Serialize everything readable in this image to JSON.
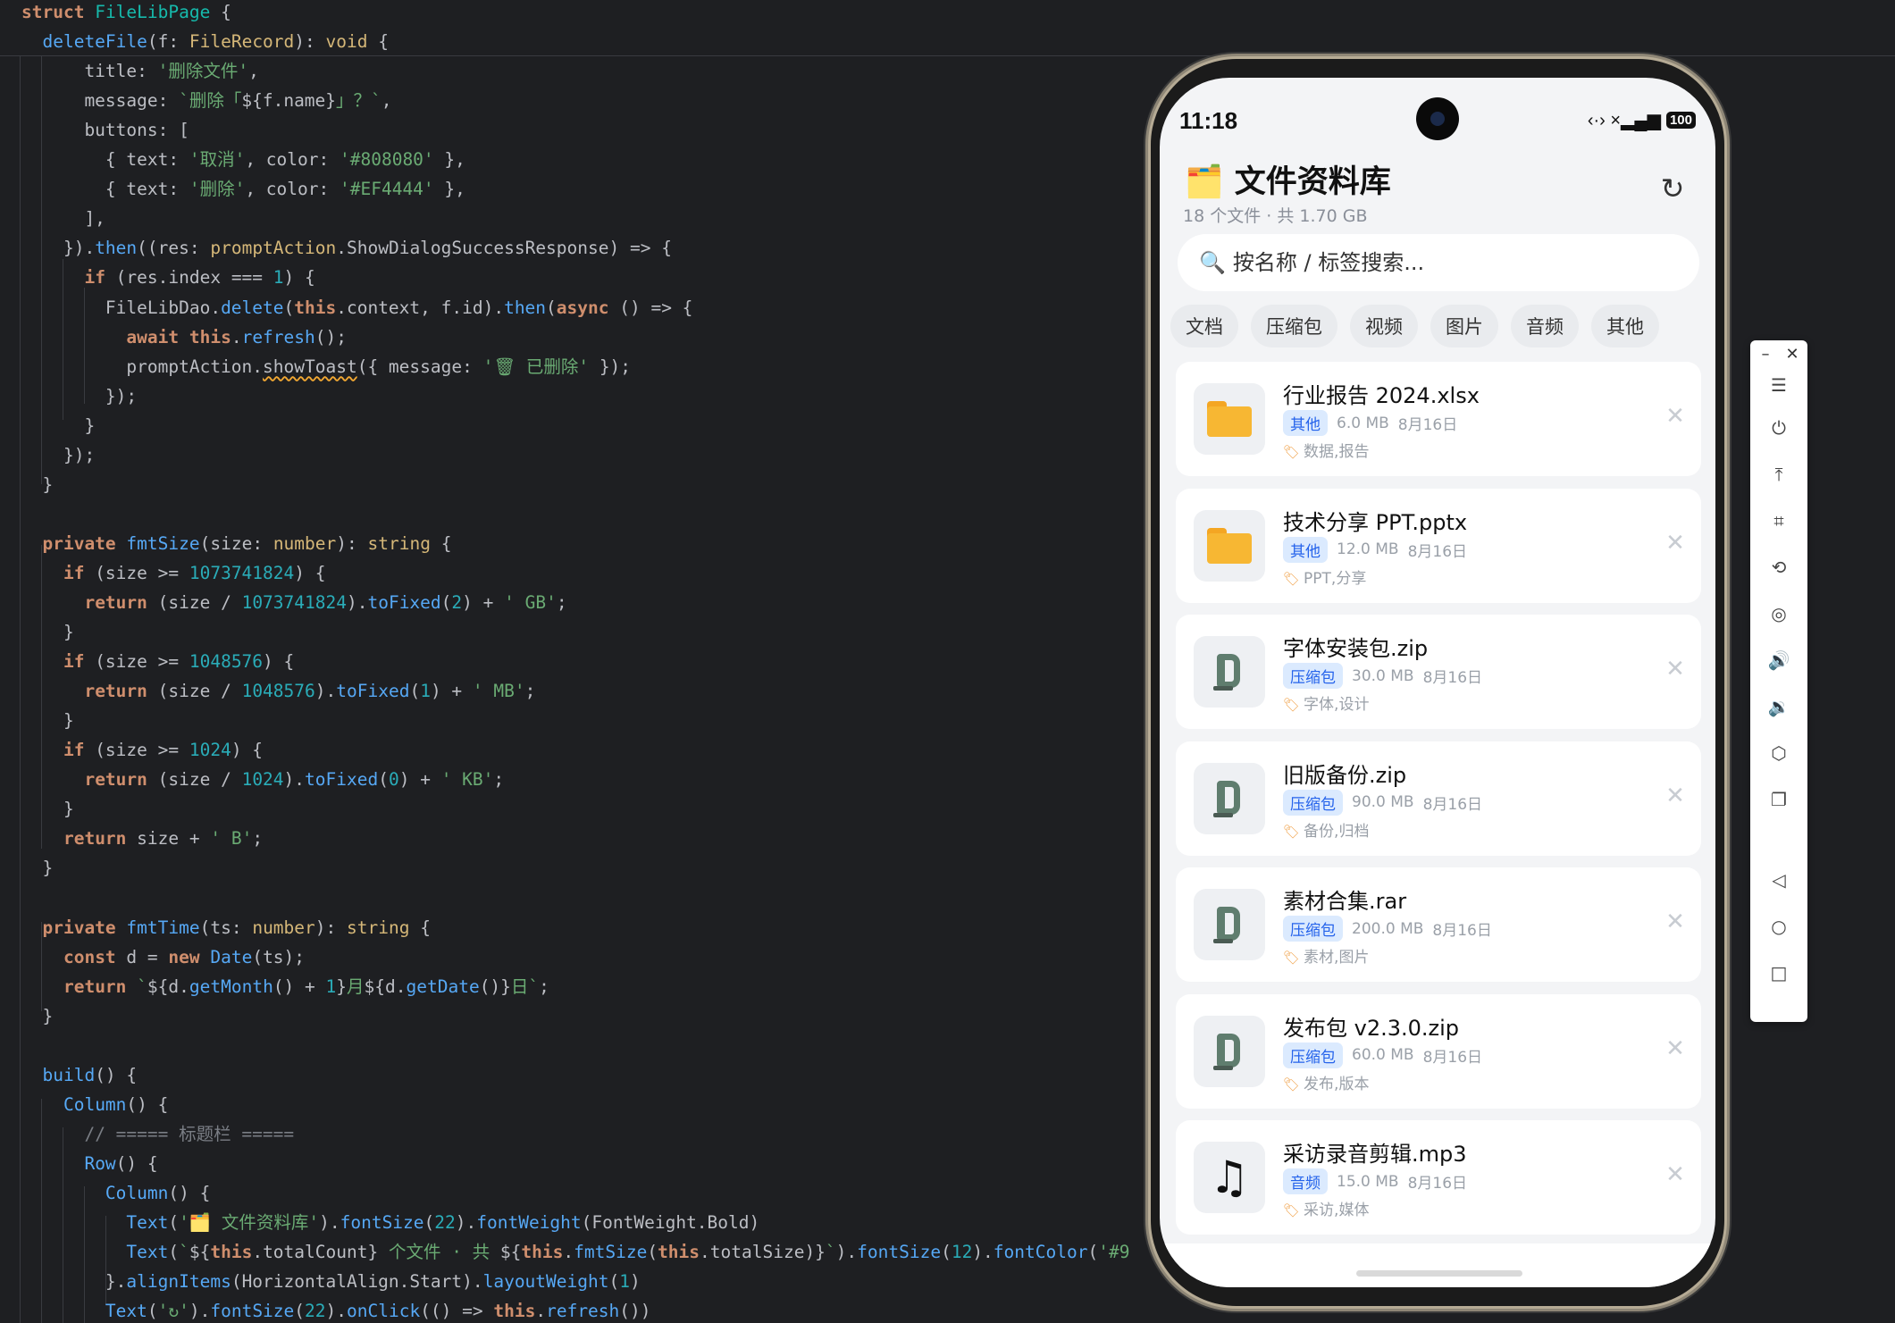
{
  "editor": {
    "lines": [
      [
        [
          "kw",
          "struct"
        ],
        [
          "plain",
          " "
        ],
        [
          "tybrand",
          "FileLibPage"
        ],
        [
          "punct",
          " {"
        ]
      ],
      [
        [
          "plain",
          "  "
        ],
        [
          "fn",
          "deleteFile"
        ],
        [
          "punct",
          "("
        ],
        [
          "plain",
          "f"
        ],
        [
          "punct",
          ": "
        ],
        [
          "param",
          "FileRecord"
        ],
        [
          "punct",
          "): "
        ],
        [
          "param",
          "void"
        ],
        [
          "punct",
          " {"
        ]
      ],
      [
        [
          "plain",
          "      title: "
        ],
        [
          "str",
          "'删除文件'"
        ],
        [
          "punct",
          ","
        ]
      ],
      [
        [
          "plain",
          "      message: "
        ],
        [
          "str",
          "`删除「"
        ],
        [
          "punct",
          "${"
        ],
        [
          "plain",
          "f.name"
        ],
        [
          "punct",
          "}"
        ],
        [
          "str",
          "」？`"
        ],
        [
          "punct",
          ","
        ]
      ],
      [
        [
          "plain",
          "      buttons: ["
        ]
      ],
      [
        [
          "plain",
          "        { text: "
        ],
        [
          "str",
          "'取消'"
        ],
        [
          "plain",
          ", color: "
        ],
        [
          "str",
          "'#808080'"
        ],
        [
          "plain",
          " },"
        ]
      ],
      [
        [
          "plain",
          "        { text: "
        ],
        [
          "str",
          "'删除'"
        ],
        [
          "plain",
          ", color: "
        ],
        [
          "str",
          "'#EF4444'"
        ],
        [
          "plain",
          " },"
        ]
      ],
      [
        [
          "plain",
          "      ],"
        ]
      ],
      [
        [
          "plain",
          "    })."
        ],
        [
          "fn",
          "then"
        ],
        [
          "punct",
          "(("
        ],
        [
          "plain",
          "res"
        ],
        [
          "punct",
          ": "
        ],
        [
          "param",
          "promptAction"
        ],
        [
          "punct",
          "."
        ],
        [
          "plain",
          "ShowDialogSuccessResponse"
        ],
        [
          "punct",
          ") => {"
        ]
      ],
      [
        [
          "plain",
          "      "
        ],
        [
          "kw",
          "if"
        ],
        [
          "plain",
          " (res.index === "
        ],
        [
          "num",
          "1"
        ],
        [
          "plain",
          ") {"
        ]
      ],
      [
        [
          "plain",
          "        FileLibDao."
        ],
        [
          "fn",
          "delete"
        ],
        [
          "punct",
          "("
        ],
        [
          "kw",
          "this"
        ],
        [
          "plain",
          ".context, f.id)."
        ],
        [
          "fn",
          "then"
        ],
        [
          "punct",
          "("
        ],
        [
          "kw",
          "async"
        ],
        [
          "plain",
          " () => {"
        ]
      ],
      [
        [
          "plain",
          "          "
        ],
        [
          "kw",
          "await"
        ],
        [
          "plain",
          " "
        ],
        [
          "kw",
          "this"
        ],
        [
          "plain",
          "."
        ],
        [
          "fn",
          "refresh"
        ],
        [
          "plain",
          "();"
        ]
      ],
      [
        [
          "plain",
          "          promptAction."
        ],
        [
          "warn",
          "showToast"
        ],
        [
          "plain",
          "({ message: "
        ],
        [
          "str",
          "'🗑 已删除'"
        ],
        [
          "plain",
          " });"
        ]
      ],
      [
        [
          "plain",
          "        });"
        ]
      ],
      [
        [
          "plain",
          "      }"
        ]
      ],
      [
        [
          "plain",
          "    });"
        ]
      ],
      [
        [
          "plain",
          "  }"
        ]
      ],
      [
        [
          "plain",
          ""
        ]
      ],
      [
        [
          "plain",
          "  "
        ],
        [
          "kw",
          "private"
        ],
        [
          "plain",
          " "
        ],
        [
          "fn",
          "fmtSize"
        ],
        [
          "punct",
          "("
        ],
        [
          "plain",
          "size"
        ],
        [
          "punct",
          ": "
        ],
        [
          "param",
          "number"
        ],
        [
          "punct",
          "): "
        ],
        [
          "param",
          "string"
        ],
        [
          "punct",
          " {"
        ]
      ],
      [
        [
          "plain",
          "    "
        ],
        [
          "kw",
          "if"
        ],
        [
          "plain",
          " (size >= "
        ],
        [
          "num",
          "1073741824"
        ],
        [
          "plain",
          ") {"
        ]
      ],
      [
        [
          "plain",
          "      "
        ],
        [
          "kw",
          "return"
        ],
        [
          "plain",
          " (size / "
        ],
        [
          "num",
          "1073741824"
        ],
        [
          "plain",
          ")."
        ],
        [
          "fn",
          "toFixed"
        ],
        [
          "punct",
          "("
        ],
        [
          "num",
          "2"
        ],
        [
          "punct",
          ")"
        ],
        [
          "plain",
          " + "
        ],
        [
          "str",
          "' GB'"
        ],
        [
          "plain",
          ";"
        ]
      ],
      [
        [
          "plain",
          "    }"
        ]
      ],
      [
        [
          "plain",
          "    "
        ],
        [
          "kw",
          "if"
        ],
        [
          "plain",
          " (size >= "
        ],
        [
          "num",
          "1048576"
        ],
        [
          "plain",
          ") {"
        ]
      ],
      [
        [
          "plain",
          "      "
        ],
        [
          "kw",
          "return"
        ],
        [
          "plain",
          " (size / "
        ],
        [
          "num",
          "1048576"
        ],
        [
          "plain",
          ")."
        ],
        [
          "fn",
          "toFixed"
        ],
        [
          "punct",
          "("
        ],
        [
          "num",
          "1"
        ],
        [
          "punct",
          ")"
        ],
        [
          "plain",
          " + "
        ],
        [
          "str",
          "' MB'"
        ],
        [
          "plain",
          ";"
        ]
      ],
      [
        [
          "plain",
          "    }"
        ]
      ],
      [
        [
          "plain",
          "    "
        ],
        [
          "kw",
          "if"
        ],
        [
          "plain",
          " (size >= "
        ],
        [
          "num",
          "1024"
        ],
        [
          "plain",
          ") {"
        ]
      ],
      [
        [
          "plain",
          "      "
        ],
        [
          "kw",
          "return"
        ],
        [
          "plain",
          " (size / "
        ],
        [
          "num",
          "1024"
        ],
        [
          "plain",
          ")."
        ],
        [
          "fn",
          "toFixed"
        ],
        [
          "punct",
          "("
        ],
        [
          "num",
          "0"
        ],
        [
          "punct",
          ")"
        ],
        [
          "plain",
          " + "
        ],
        [
          "str",
          "' KB'"
        ],
        [
          "plain",
          ";"
        ]
      ],
      [
        [
          "plain",
          "    }"
        ]
      ],
      [
        [
          "plain",
          "    "
        ],
        [
          "kw",
          "return"
        ],
        [
          "plain",
          " size + "
        ],
        [
          "str",
          "' B'"
        ],
        [
          "plain",
          ";"
        ]
      ],
      [
        [
          "plain",
          "  }"
        ]
      ],
      [
        [
          "plain",
          ""
        ]
      ],
      [
        [
          "plain",
          "  "
        ],
        [
          "kw",
          "private"
        ],
        [
          "plain",
          " "
        ],
        [
          "fn",
          "fmtTime"
        ],
        [
          "punct",
          "("
        ],
        [
          "plain",
          "ts"
        ],
        [
          "punct",
          ": "
        ],
        [
          "param",
          "number"
        ],
        [
          "punct",
          "): "
        ],
        [
          "param",
          "string"
        ],
        [
          "punct",
          " {"
        ]
      ],
      [
        [
          "plain",
          "    "
        ],
        [
          "kw",
          "const"
        ],
        [
          "plain",
          " d = "
        ],
        [
          "kw",
          "new"
        ],
        [
          "plain",
          " "
        ],
        [
          "fn",
          "Date"
        ],
        [
          "plain",
          "(ts);"
        ]
      ],
      [
        [
          "plain",
          "    "
        ],
        [
          "kw",
          "return"
        ],
        [
          "plain",
          " "
        ],
        [
          "str",
          "`"
        ],
        [
          "punct",
          "${"
        ],
        [
          "plain",
          "d."
        ],
        [
          "fn",
          "getMonth"
        ],
        [
          "plain",
          "() + "
        ],
        [
          "num",
          "1"
        ],
        [
          "punct",
          "}"
        ],
        [
          "str",
          "月"
        ],
        [
          "punct",
          "${"
        ],
        [
          "plain",
          "d."
        ],
        [
          "fn",
          "getDate"
        ],
        [
          "plain",
          "()"
        ],
        [
          "punct",
          "}"
        ],
        [
          "str",
          "日`"
        ],
        [
          "plain",
          ";"
        ]
      ],
      [
        [
          "plain",
          "  }"
        ]
      ],
      [
        [
          "plain",
          ""
        ]
      ],
      [
        [
          "plain",
          "  "
        ],
        [
          "fn",
          "build"
        ],
        [
          "plain",
          "() {"
        ]
      ],
      [
        [
          "plain",
          "    "
        ],
        [
          "fnlocal",
          "Column"
        ],
        [
          "plain",
          "() {"
        ]
      ],
      [
        [
          "plain",
          "      "
        ],
        [
          "cm",
          "// ===== 标题栏 ====="
        ]
      ],
      [
        [
          "plain",
          "      "
        ],
        [
          "fnlocal",
          "Row"
        ],
        [
          "plain",
          "() {"
        ]
      ],
      [
        [
          "plain",
          "        "
        ],
        [
          "fnlocal",
          "Column"
        ],
        [
          "plain",
          "() {"
        ]
      ],
      [
        [
          "plain",
          "          "
        ],
        [
          "fnlocal",
          "Text"
        ],
        [
          "punct",
          "("
        ],
        [
          "str",
          "'🗂️ 文件资料库'"
        ],
        [
          "punct",
          ")."
        ],
        [
          "fn",
          "fontSize"
        ],
        [
          "punct",
          "("
        ],
        [
          "num",
          "22"
        ],
        [
          "punct",
          ")."
        ],
        [
          "fn",
          "fontWeight"
        ],
        [
          "punct",
          "("
        ],
        [
          "plain",
          "FontWeight.Bold"
        ],
        [
          "punct",
          ")"
        ]
      ],
      [
        [
          "plain",
          "          "
        ],
        [
          "fnlocal",
          "Text"
        ],
        [
          "punct",
          "("
        ],
        [
          "str",
          "`"
        ],
        [
          "punct",
          "${"
        ],
        [
          "kw",
          "this"
        ],
        [
          "plain",
          ".totalCount"
        ],
        [
          "punct",
          "}"
        ],
        [
          "str",
          " 个文件 · 共 "
        ],
        [
          "punct",
          "${"
        ],
        [
          "kw",
          "this"
        ],
        [
          "plain",
          "."
        ],
        [
          "fn",
          "fmtSize"
        ],
        [
          "punct",
          "("
        ],
        [
          "kw",
          "this"
        ],
        [
          "plain",
          ".totalSize"
        ],
        [
          "punct",
          ")}"
        ],
        [
          "str",
          "`"
        ],
        [
          "punct",
          ")."
        ],
        [
          "fn",
          "fontSize"
        ],
        [
          "punct",
          "("
        ],
        [
          "num",
          "12"
        ],
        [
          "punct",
          ")."
        ],
        [
          "fn",
          "fontColor"
        ],
        [
          "punct",
          "("
        ],
        [
          "str",
          "'#9"
        ]
      ],
      [
        [
          "plain",
          "        }."
        ],
        [
          "fn",
          "alignItems"
        ],
        [
          "punct",
          "("
        ],
        [
          "plain",
          "HorizontalAlign.Start"
        ],
        [
          "punct",
          ")."
        ],
        [
          "fn",
          "layoutWeight"
        ],
        [
          "punct",
          "("
        ],
        [
          "num",
          "1"
        ],
        [
          "punct",
          ")"
        ]
      ],
      [
        [
          "plain",
          "        "
        ],
        [
          "fnlocal",
          "Text"
        ],
        [
          "punct",
          "("
        ],
        [
          "str",
          "'↻'"
        ],
        [
          "punct",
          ")."
        ],
        [
          "fn",
          "fontSize"
        ],
        [
          "punct",
          "("
        ],
        [
          "num",
          "22"
        ],
        [
          "punct",
          ")."
        ],
        [
          "fn",
          "onClick"
        ],
        [
          "punct",
          "(() => "
        ],
        [
          "kw",
          "this"
        ],
        [
          "plain",
          "."
        ],
        [
          "fn",
          "refresh"
        ],
        [
          "plain",
          "())"
        ]
      ]
    ]
  },
  "toolbar": {
    "minimize_label": "–",
    "close_label": "✕",
    "buttons": [
      {
        "name": "menu-icon",
        "glyph": "☰"
      },
      {
        "name": "power-icon",
        "glyph": "⏻"
      },
      {
        "name": "to-top-icon",
        "glyph": "⤒"
      },
      {
        "name": "crop-icon",
        "glyph": "⌗"
      },
      {
        "name": "rotate-icon",
        "glyph": "⟲"
      },
      {
        "name": "screenshot-icon",
        "glyph": "◎"
      },
      {
        "name": "volume-up-icon",
        "glyph": "🔊"
      },
      {
        "name": "volume-down-icon",
        "glyph": "🔉"
      },
      {
        "name": "shake-icon",
        "glyph": "⬡"
      },
      {
        "name": "multi-device-icon",
        "glyph": "❐"
      },
      {
        "name": "back-icon",
        "glyph": "◁"
      },
      {
        "name": "home-icon",
        "glyph": "○"
      },
      {
        "name": "recents-icon",
        "glyph": "□"
      }
    ]
  },
  "phone": {
    "status": {
      "time": "11:18",
      "signal_glyph": "‹·›  ×▂▄▆",
      "battery": "100"
    },
    "header": {
      "title": "🗂️ 文件资料库",
      "subtitle": "18 个文件 · 共 1.70 GB",
      "refresh_glyph": "↻"
    },
    "search": {
      "icon_glyph": "🔍",
      "placeholder": "按名称 / 标签搜索..."
    },
    "filters": [
      "文档",
      "压缩包",
      "视频",
      "图片",
      "音频",
      "其他"
    ],
    "files": [
      {
        "name": "行业报告 2024.xlsx",
        "category": "其他",
        "size": "6.0 MB",
        "date": "8月16日",
        "tags": "数据,报告",
        "icon": "folder"
      },
      {
        "name": "技术分享 PPT.pptx",
        "category": "其他",
        "size": "12.0 MB",
        "date": "8月16日",
        "tags": "PPT,分享",
        "icon": "folder"
      },
      {
        "name": "字体安装包.zip",
        "category": "压缩包",
        "size": "30.0 MB",
        "date": "8月16日",
        "tags": "字体,设计",
        "icon": "clamp"
      },
      {
        "name": "旧版备份.zip",
        "category": "压缩包",
        "size": "90.0 MB",
        "date": "8月16日",
        "tags": "备份,归档",
        "icon": "clamp"
      },
      {
        "name": "素材合集.rar",
        "category": "压缩包",
        "size": "200.0 MB",
        "date": "8月16日",
        "tags": "素材,图片",
        "icon": "clamp"
      },
      {
        "name": "发布包 v2.3.0.zip",
        "category": "压缩包",
        "size": "60.0 MB",
        "date": "8月16日",
        "tags": "发布,版本",
        "icon": "clamp"
      },
      {
        "name": "采访录音剪辑.mp3",
        "category": "音频",
        "size": "15.0 MB",
        "date": "8月16日",
        "tags": "采访,媒体",
        "icon": "note"
      }
    ],
    "delete_glyph": "✕",
    "tag_glyph": "🏷"
  },
  "colors": {
    "editor_bg": "#1e1f22",
    "badge_text": "#2563eb",
    "badge_bg": "#dbeafe",
    "screen_bg": "#f3f4f6"
  }
}
